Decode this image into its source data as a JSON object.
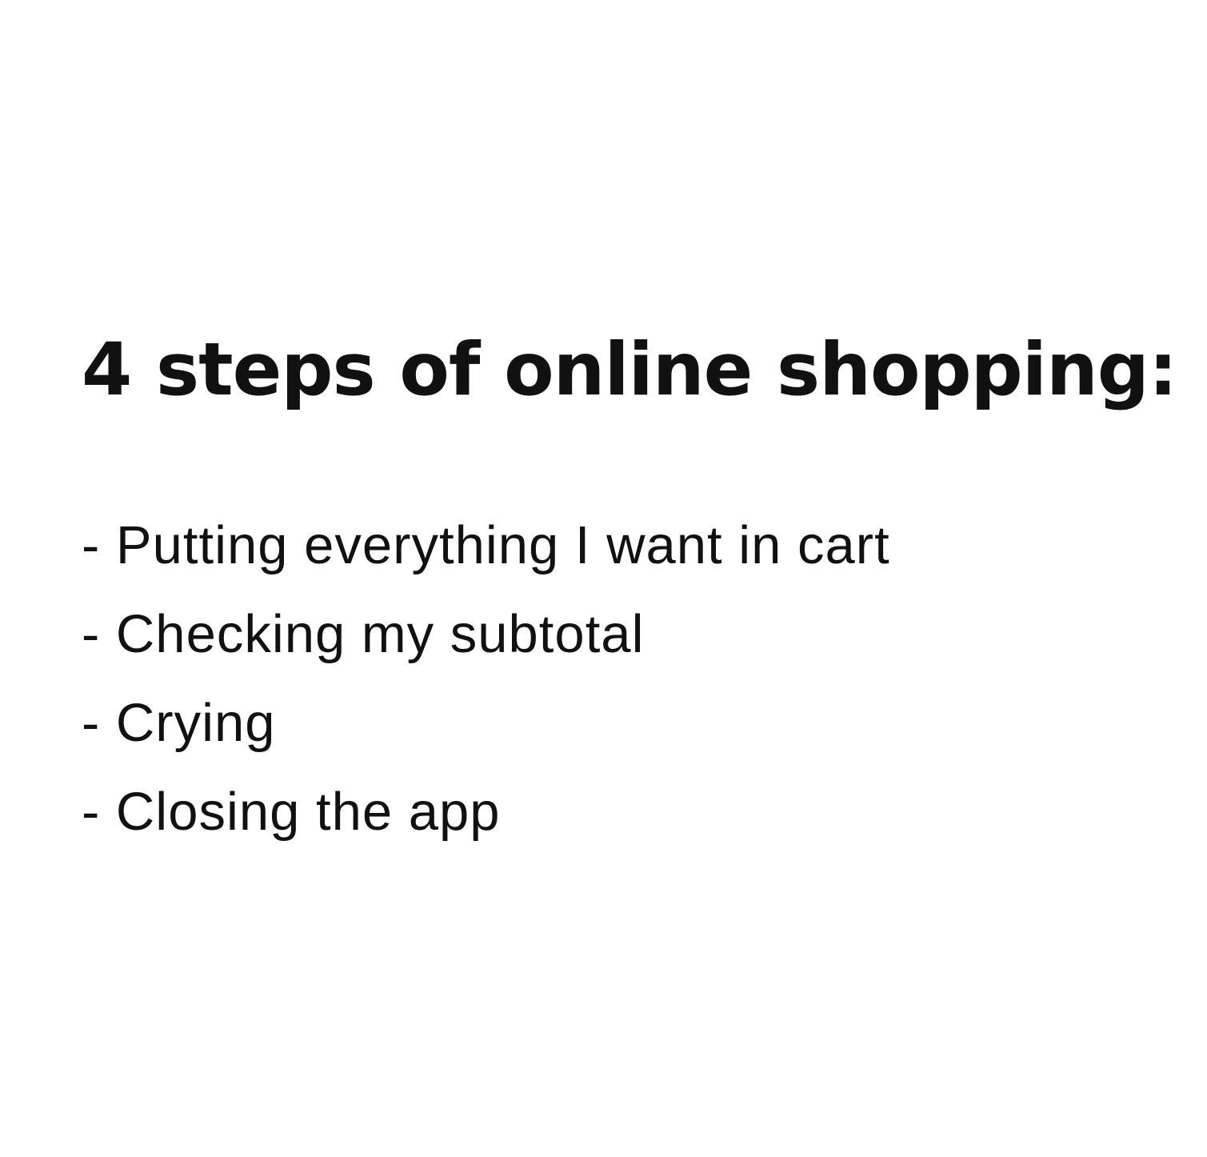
{
  "title": "4 steps of online shopping:",
  "steps": [
    "- Putting everything I want in cart",
    "- Checking my subtotal",
    "- Crying",
    "- Closing the app"
  ]
}
